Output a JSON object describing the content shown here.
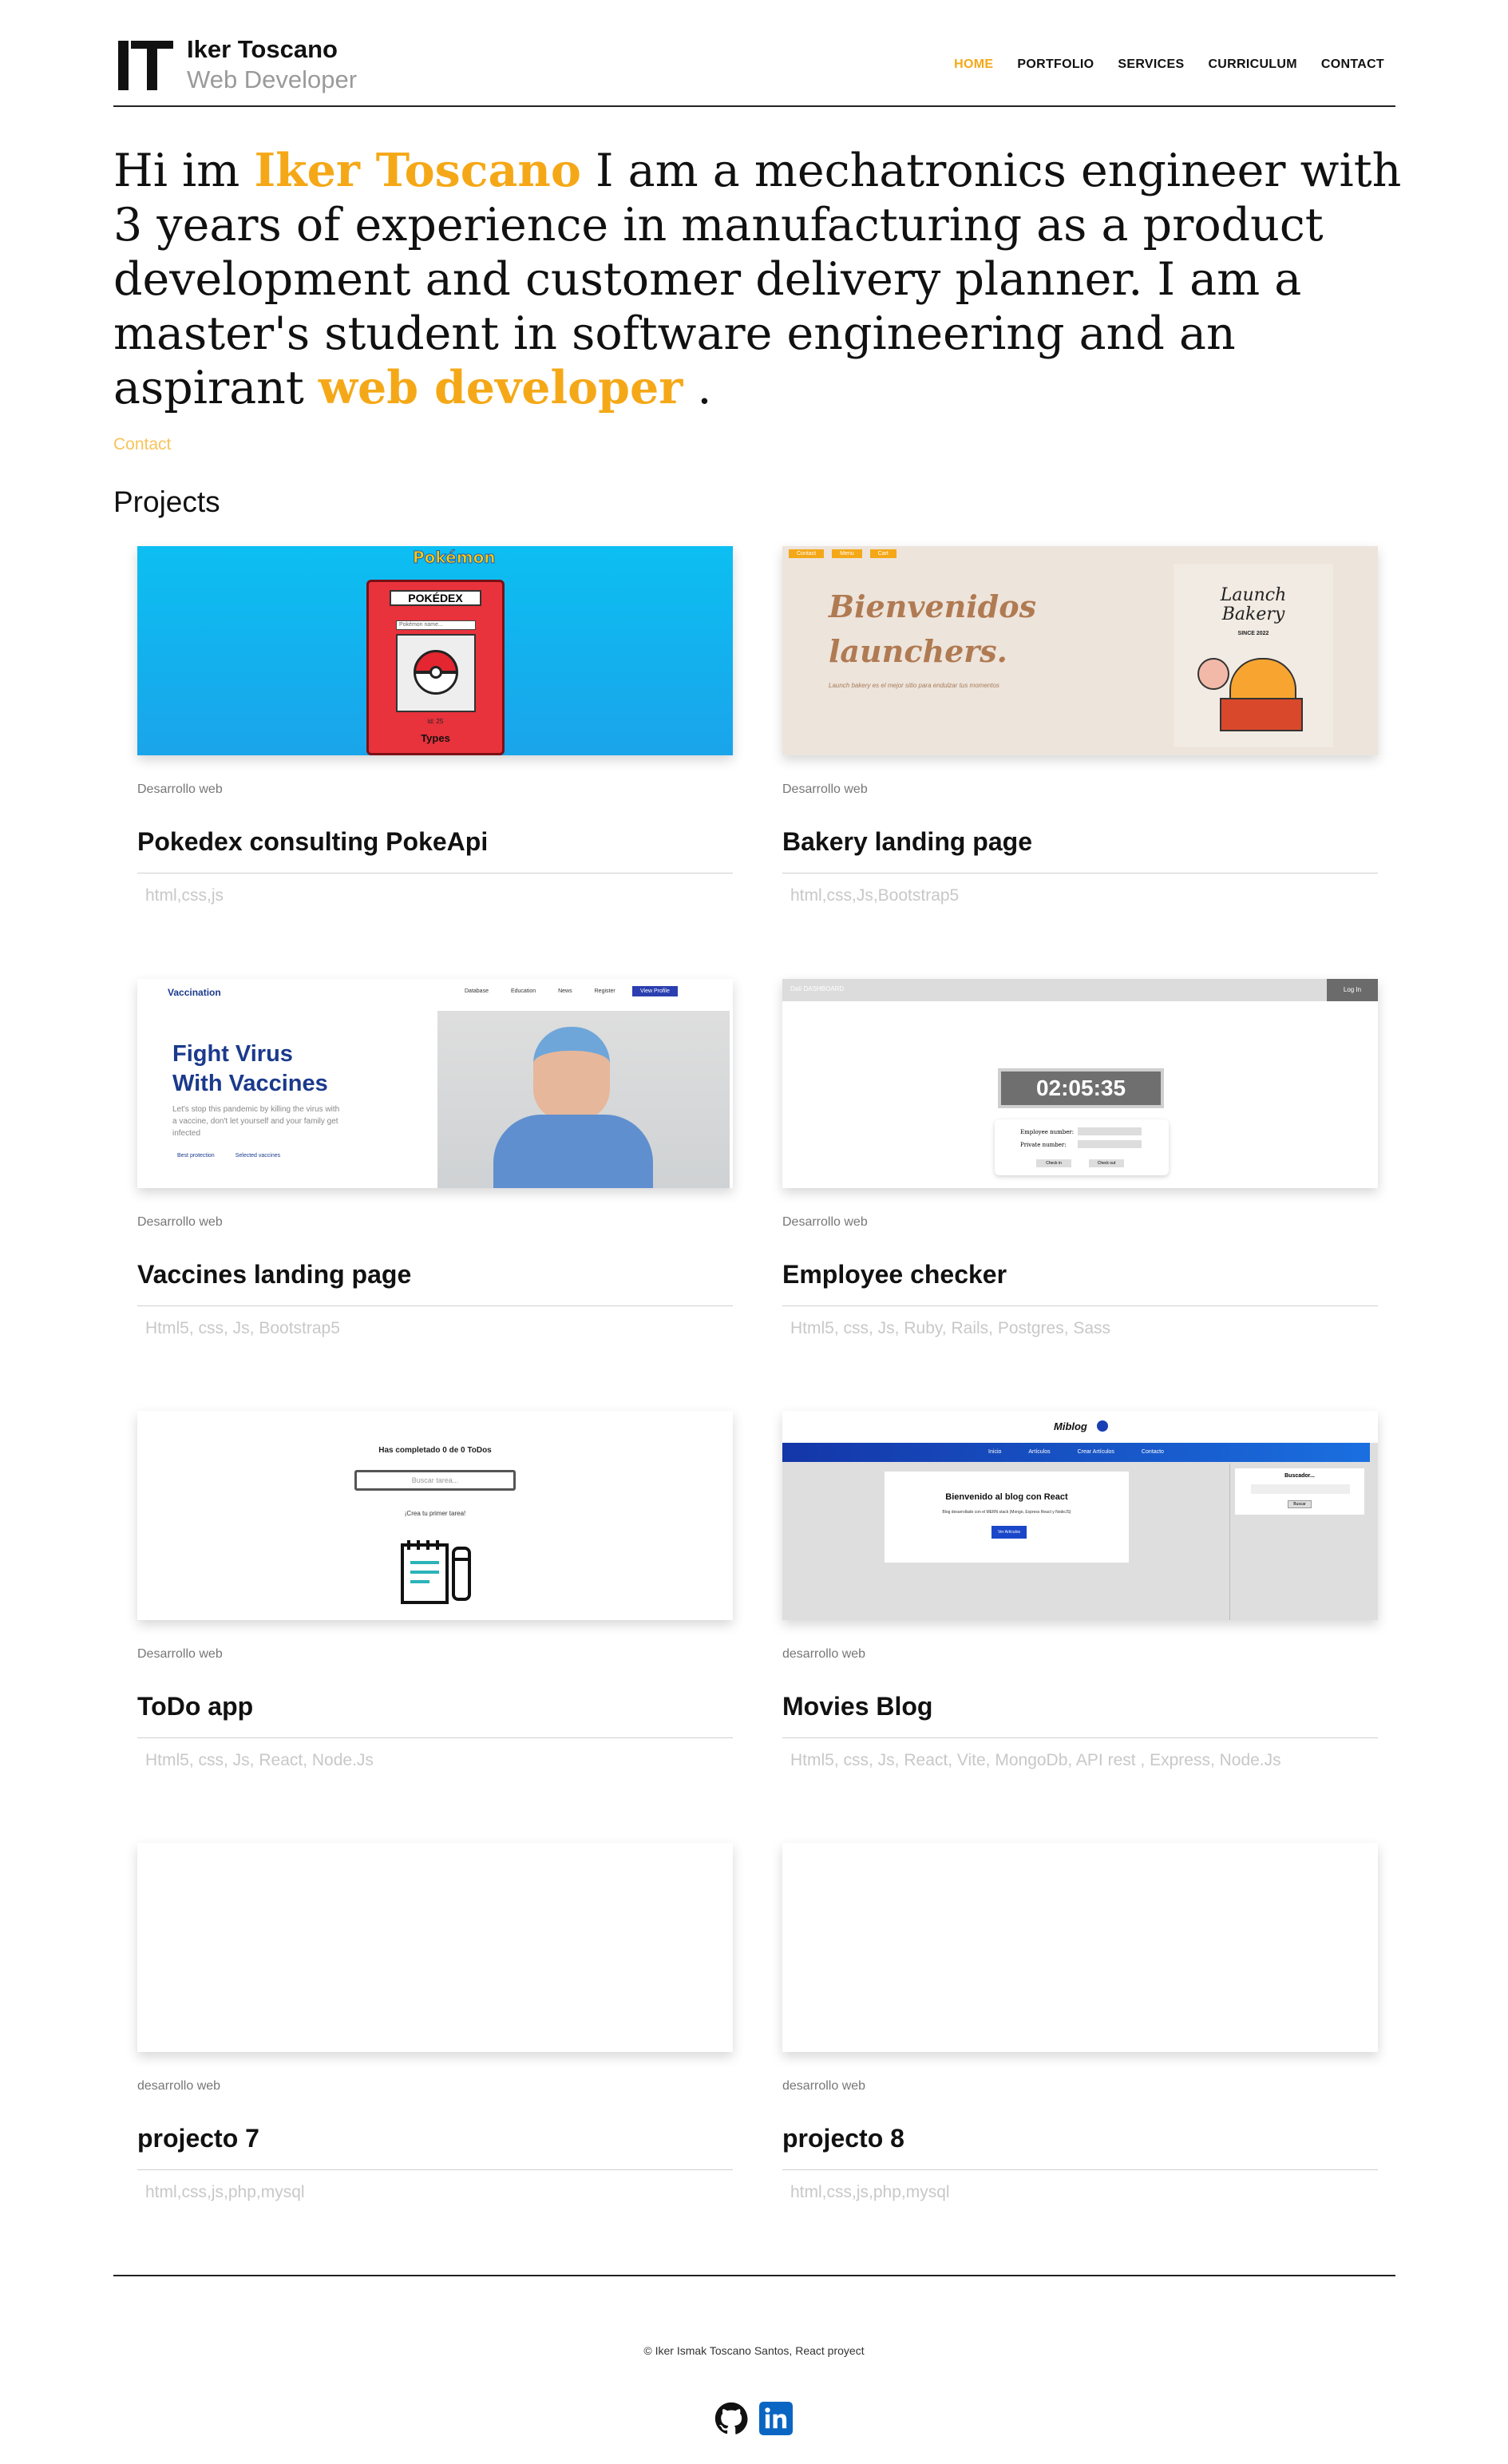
{
  "header": {
    "logo_mark": "IT",
    "name": "Iker Toscano",
    "role": "Web Developer",
    "nav": [
      "HOME",
      "PORTFOLIO",
      "SERVICES",
      "CURRICULUM",
      "CONTACT"
    ],
    "accent_color": "#f5a817"
  },
  "hero": {
    "intro": "Hi im ",
    "name": "Iker Toscano",
    "text": " I am a mechatronics engineer with 3 years of experience in manufacturing as a product development and customer delivery planner. I am a master's student in software engineering and an aspirant ",
    "highlight": "web developer",
    "end": " ."
  },
  "contact_link": "Contact",
  "projects_title": "Projects",
  "projects": [
    {
      "category": "Desarrollo web",
      "title": "Pokedex consulting PokeApi",
      "tags": "html,css,js"
    },
    {
      "category": "Desarrollo web",
      "title": "Bakery landing page",
      "tags": "html,css,Js,Bootstrap5"
    },
    {
      "category": "Desarrollo web",
      "title": "Vaccines landing page",
      "tags": "Html5, css, Js, Bootstrap5"
    },
    {
      "category": "Desarrollo web",
      "title": "Employee checker",
      "tags": "Html5, css, Js, Ruby, Rails, Postgres, Sass"
    },
    {
      "category": "Desarrollo web",
      "title": "ToDo app",
      "tags": "Html5, css, Js, React, Node.Js"
    },
    {
      "category": "desarrollo web",
      "title": "Movies Blog",
      "tags": "Html5, css, Js, React, Vite, MongoDb, API rest , Express, Node.Js"
    },
    {
      "category": "desarrollo web",
      "title": "projecto 7",
      "tags": "html,css,js,php,mysql"
    },
    {
      "category": "desarrollo web",
      "title": "projecto 8",
      "tags": "html,css,js,php,mysql"
    }
  ],
  "thumbs": {
    "pokedex": {
      "banner": "Pokémon",
      "title": "POKÉDEX",
      "input": "Pokémon name...",
      "stats": "id: 25",
      "types": "Types"
    },
    "bakery": {
      "buttons": [
        "Contact",
        "Menu",
        "Cart"
      ],
      "heading": "Bienvenidos launchers.",
      "desc": "Launch bakery es el mejor sitio para endulzar tus momentos",
      "logo": "Launch Bakery",
      "since": "SINCE 2022"
    },
    "vaccines": {
      "brand": "Vaccination",
      "nav": [
        "Database",
        "Education",
        "News",
        "Register"
      ],
      "button": "View Profile",
      "heading": "Fight Virus With Vaccines",
      "desc": "Let's stop this pandemic by killing the virus with a vaccine, don't let yourself and your family get infected",
      "badges": [
        "Best protection",
        "Selected vaccines"
      ]
    },
    "employee": {
      "left": "Dalí   DASHBOARD",
      "login": "Log In",
      "clock": "02:05:35",
      "fields": [
        "Employee number:",
        "Private number:"
      ],
      "buttons": [
        "Check in",
        "Check out"
      ]
    },
    "todo": {
      "status": "Has completado 0 de 0 ToDos",
      "search": "Buscar tarea...",
      "empty": "¡Crea tu primer tarea!"
    },
    "blog": {
      "brand": "Miblog",
      "nav": [
        "Inicio",
        "Artículos",
        "Crear Artículos",
        "Contacto"
      ],
      "heading": "Bienvenido al blog con React",
      "desc": "Blog desarrollado con el MERN stack (Mongo, Express React y NodeJS)",
      "button": "Ver Artículos",
      "search_title": "Buscador...",
      "search_button": "Buscar"
    }
  },
  "footer": {
    "copyright": "© Iker Ismak Toscano Santos, React proyect"
  }
}
